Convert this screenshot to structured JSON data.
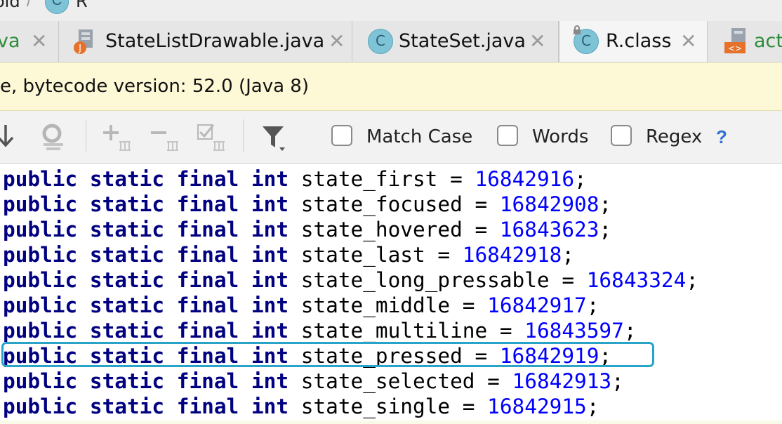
{
  "breadcrumb": {
    "parent_fragment": "oid",
    "separator": "/",
    "class_icon_letter": "C",
    "current": "R"
  },
  "tabs": [
    {
      "label": "va",
      "type": "java"
    },
    {
      "label": "StateListDrawable.java",
      "type": "java"
    },
    {
      "label": "StateSet.java",
      "type": "class"
    },
    {
      "label": "R.class",
      "type": "class",
      "active": true
    },
    {
      "label": "act",
      "type": "xml"
    }
  ],
  "tab_close_glyph": "✕",
  "banner": {
    "text": "e, bytecode version: 52.0 (Java 8)"
  },
  "find_toolbar": {
    "options": [
      {
        "label": "Match Case",
        "checked": false
      },
      {
        "label": "Words",
        "checked": false
      },
      {
        "label": "Regex",
        "checked": false
      }
    ],
    "help_label": "?"
  },
  "code_lines": [
    {
      "modifiers": [
        "public",
        "static",
        "final",
        "int"
      ],
      "name": "state_first",
      "value": "16842916"
    },
    {
      "modifiers": [
        "public",
        "static",
        "final",
        "int"
      ],
      "name": "state_focused",
      "value": "16842908"
    },
    {
      "modifiers": [
        "public",
        "static",
        "final",
        "int"
      ],
      "name": "state_hovered",
      "value": "16843623"
    },
    {
      "modifiers": [
        "public",
        "static",
        "final",
        "int"
      ],
      "name": "state_last",
      "value": "16842918"
    },
    {
      "modifiers": [
        "public",
        "static",
        "final",
        "int"
      ],
      "name": "state_long_pressable",
      "value": "16843324"
    },
    {
      "modifiers": [
        "public",
        "static",
        "final",
        "int"
      ],
      "name": "state_middle",
      "value": "16842917"
    },
    {
      "modifiers": [
        "public",
        "static",
        "final",
        "int"
      ],
      "name": "state_multiline",
      "value": "16843597"
    },
    {
      "modifiers": [
        "public",
        "static",
        "final",
        "int"
      ],
      "name": "state_pressed",
      "value": "16842919",
      "highlighted": true
    },
    {
      "modifiers": [
        "public",
        "static",
        "final",
        "int"
      ],
      "name": "state_selected",
      "value": "16842913"
    },
    {
      "modifiers": [
        "public",
        "static",
        "final",
        "int"
      ],
      "name": "state_single",
      "value": "16842915"
    }
  ],
  "colors": {
    "keyword": "#000080",
    "number": "#0000ff",
    "highlight_border": "#2aa3c9",
    "banner_bg": "#fdf8d5"
  }
}
